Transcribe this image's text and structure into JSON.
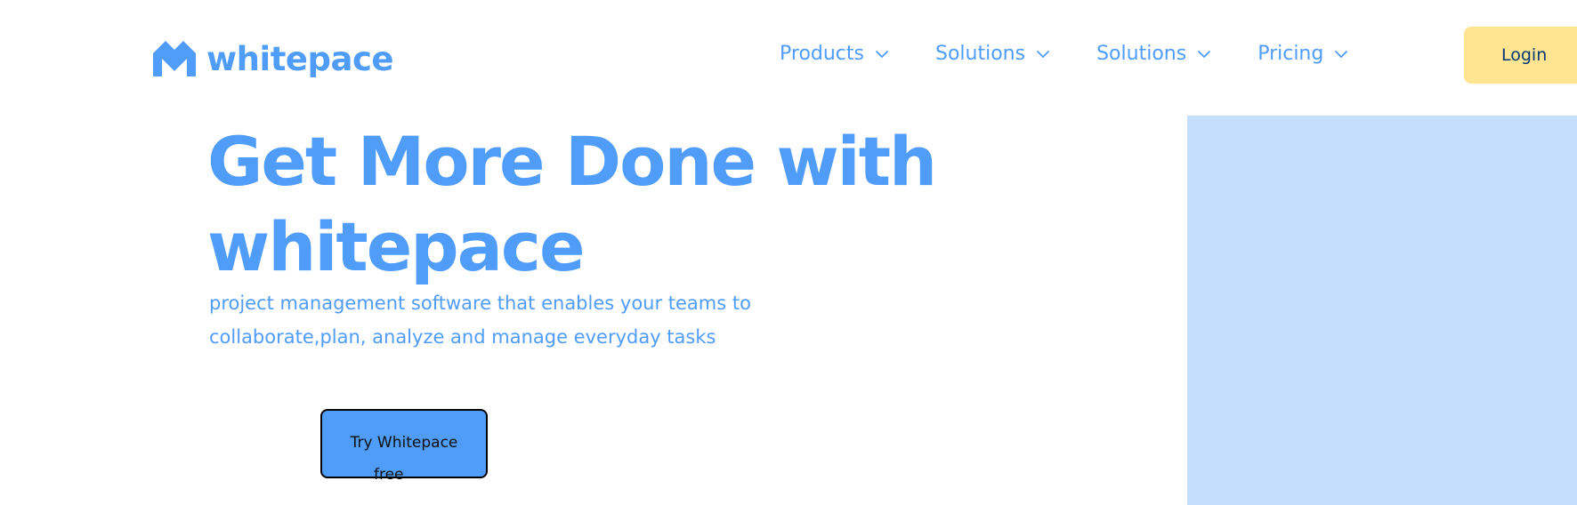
{
  "brand": {
    "name": "whitepace",
    "icon": "chevron-up-logo-icon",
    "color": "#4f9cf9"
  },
  "nav": {
    "items": [
      {
        "label": "Products",
        "icon": "chevron-down-icon"
      },
      {
        "label": "Solutions",
        "icon": "chevron-down-icon"
      },
      {
        "label": "Solutions",
        "icon": "chevron-down-icon"
      },
      {
        "label": "Pricing",
        "icon": "chevron-down-icon"
      }
    ]
  },
  "header": {
    "login_label": "Login",
    "login_color": "#ffe492",
    "login_text_color": "#043873"
  },
  "hero": {
    "title_line1": "Get More Done with",
    "title_line2": "whitepace",
    "subtitle": "project management software that enables your teams to collaborate,plan, analyze and manage everyday tasks",
    "cta_line1": "Try Whitepace",
    "cta_line2": "free",
    "cta_color": "#4f9cf9",
    "image_placeholder_color": "#c4defc"
  }
}
